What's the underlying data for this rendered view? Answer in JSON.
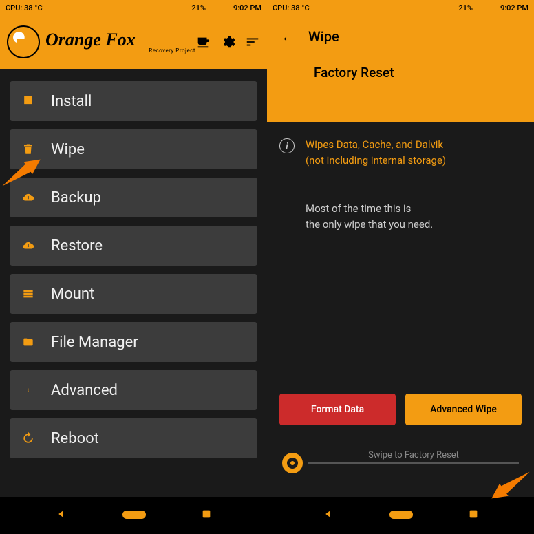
{
  "status": {
    "cpu": "CPU: 38 °C",
    "battery": "21%",
    "time": "9:02 PM"
  },
  "brand": {
    "title": "Orange Fox",
    "subtitle": "Recovery Project"
  },
  "menu": {
    "items": [
      {
        "icon": "download",
        "label": "Install"
      },
      {
        "icon": "trash",
        "label": "Wipe"
      },
      {
        "icon": "cloud-up",
        "label": "Backup"
      },
      {
        "icon": "cloud-down",
        "label": "Restore"
      },
      {
        "icon": "storage",
        "label": "Mount"
      },
      {
        "icon": "folder",
        "label": "File Manager"
      },
      {
        "icon": "dots",
        "label": "Advanced"
      },
      {
        "icon": "reboot",
        "label": "Reboot"
      }
    ]
  },
  "wipe": {
    "screen_title": "Wipe",
    "section_title": "Factory Reset",
    "info_line1": "Wipes Data, Cache, and Dalvik",
    "info_line2": "(not including internal storage)",
    "desc_line1": "Most of the time this is",
    "desc_line2": "the only wipe that you need.",
    "format_btn": "Format Data",
    "advanced_btn": "Advanced Wipe",
    "slider_label": "Swipe to Factory Reset"
  }
}
